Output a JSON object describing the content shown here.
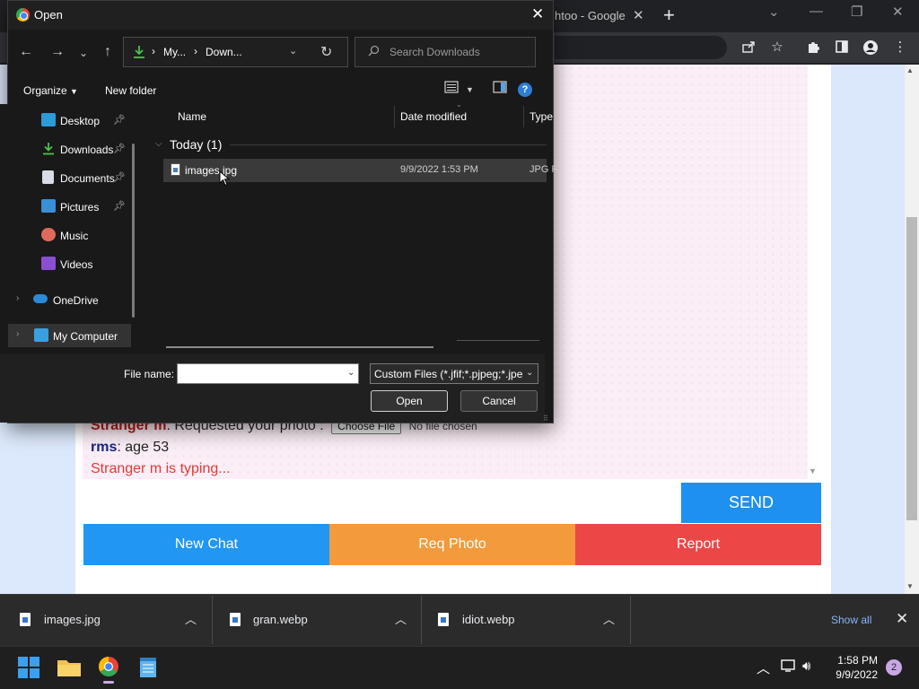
{
  "browser": {
    "tab_title": "htoo - Google",
    "tab_close": "✕",
    "new_tab": "+",
    "window_controls": [
      "⌄",
      "—",
      "❐",
      "✕"
    ],
    "toolbar_icons": [
      "share-icon",
      "star-icon",
      "puzzle-icon",
      "sidebar-icon",
      "profile-icon",
      "menu-icon"
    ]
  },
  "chat": {
    "lines": [
      {
        "name": "Stranger m",
        "text": ": Requested your photo :",
        "button": "Choose File",
        "status": "No file chosen"
      },
      {
        "name": "rms",
        "text": ": age 53"
      },
      {
        "typing": "Stranger m is typing..."
      }
    ],
    "send_label": "SEND",
    "new_chat_label": "New Chat",
    "req_photo_label": "Req Photo",
    "report_label": "Report"
  },
  "downloads": {
    "items": [
      "images.jpg",
      "gran.webp",
      "idiot.webp"
    ],
    "show_all": "Show all",
    "close": "✕"
  },
  "taskbar": {
    "time": "1:58 PM",
    "date": "9/9/2022",
    "notifications": "2"
  },
  "dialog": {
    "title": "Open",
    "close": "✕",
    "breadcrumb": [
      "My...",
      "Down..."
    ],
    "search_placeholder": "Search Downloads",
    "organize": "Organize",
    "new_folder": "New folder",
    "nav_items": [
      {
        "label": "Desktop",
        "pinned": true
      },
      {
        "label": "Downloads",
        "pinned": true
      },
      {
        "label": "Documents",
        "pinned": true
      },
      {
        "label": "Pictures",
        "pinned": true
      },
      {
        "label": "Music"
      },
      {
        "label": "Videos"
      },
      {
        "label": "OneDrive"
      },
      {
        "label": "My Computer"
      }
    ],
    "columns": [
      "Name",
      "Date modified",
      "Type"
    ],
    "group": "Today (1)",
    "files": [
      {
        "name": "images.jpg",
        "date": "9/9/2022 1:53 PM",
        "type": "JPG F"
      }
    ],
    "file_name_label": "File name:",
    "file_name_value": "",
    "file_type": "Custom Files (*.jfif;*.pjpeg;*.jpe",
    "open_label": "Open",
    "cancel_label": "Cancel"
  },
  "colors": {
    "send_blue": "#1e90f0",
    "new_chat_blue": "#2196f3",
    "req_photo_orange": "#f39a3c",
    "report_red": "#ec4646",
    "dialog_bg": "#191919"
  }
}
